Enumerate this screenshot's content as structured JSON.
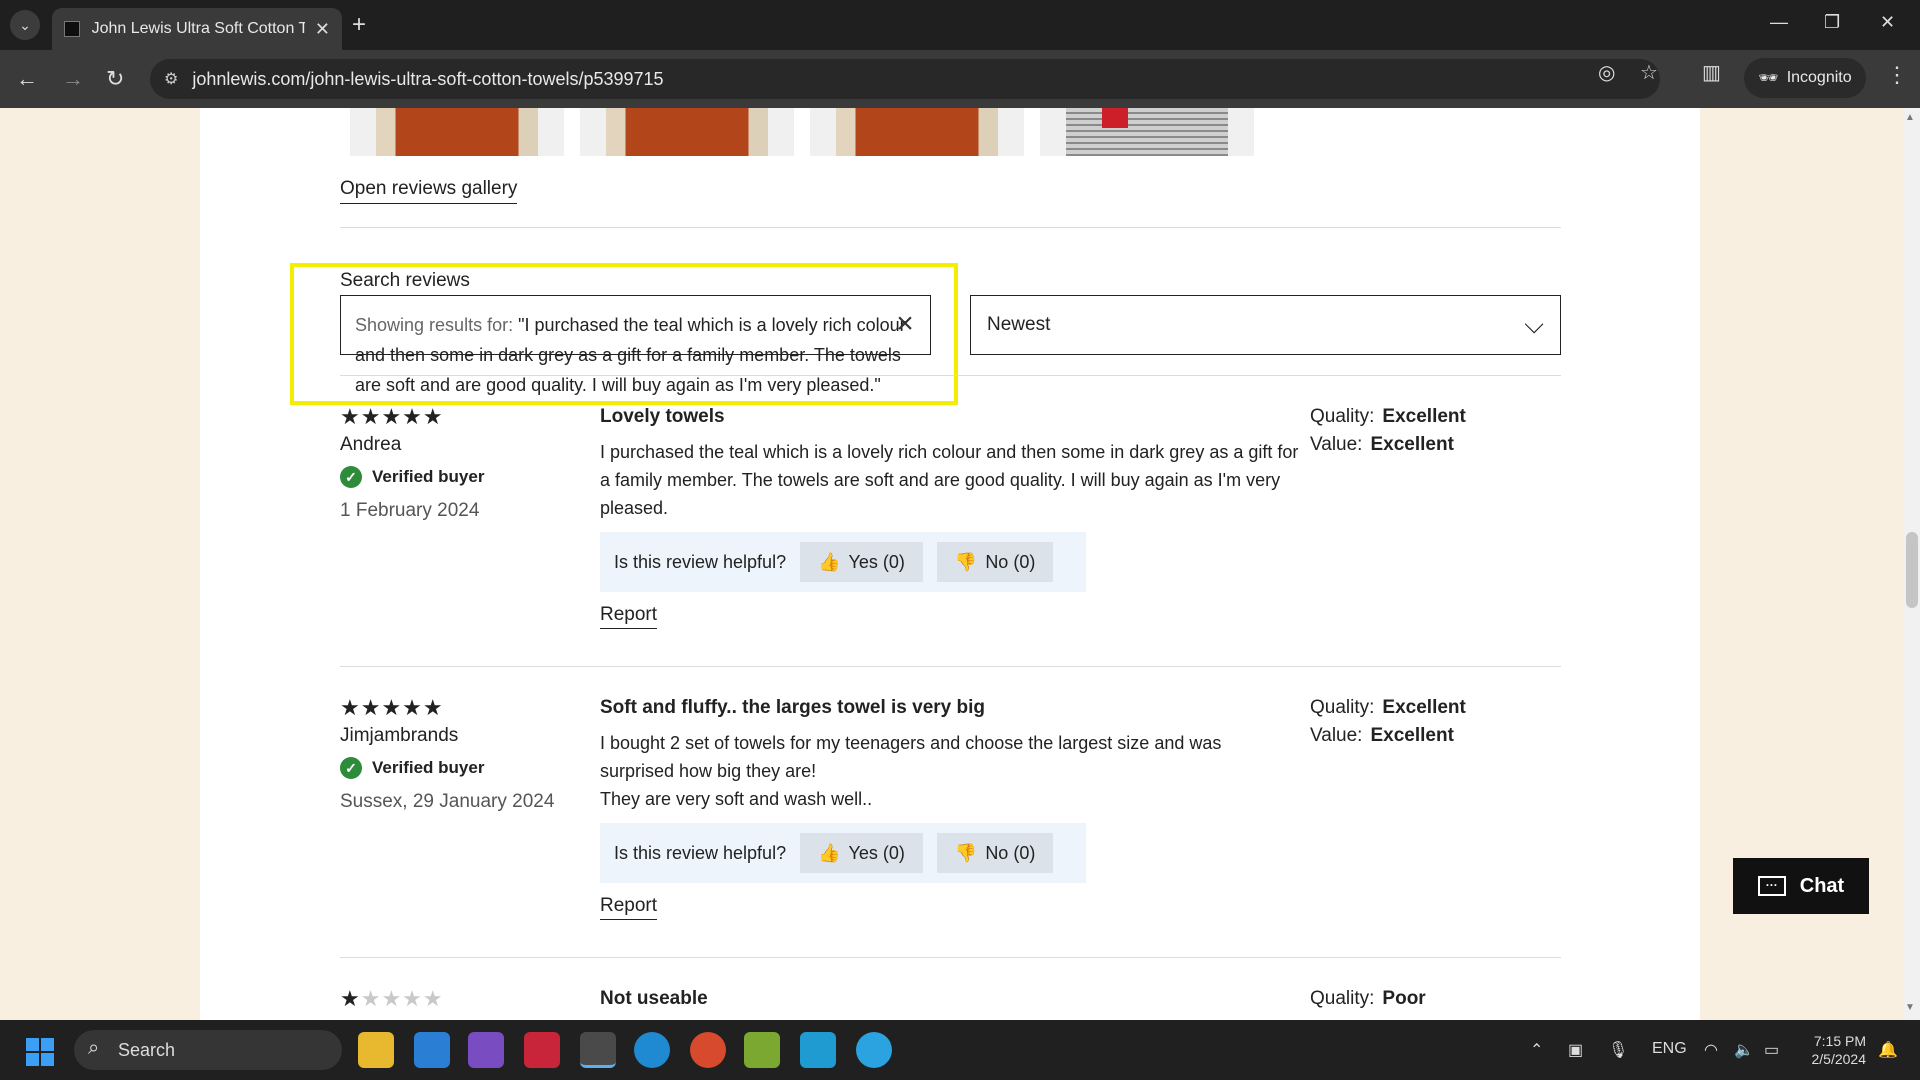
{
  "browser": {
    "tab_title": "John Lewis Ultra Soft Cotton Towels",
    "url": "johnlewis.com/john-lewis-ultra-soft-cotton-towels/p5399715",
    "incognito_label": "Incognito"
  },
  "gallery": {
    "link_label": "Open reviews gallery"
  },
  "search": {
    "label": "Search reviews",
    "prefix": "Showing results for:",
    "query": "\"I purchased the teal which is a lovely rich colour and then some in dark grey as a gift for a family member. The towels are soft and are good quality. I will buy again as I'm very pleased.\""
  },
  "sort": {
    "selected": "Newest"
  },
  "helpful_prompt": "Is this review helpful?",
  "report_label": "Report",
  "verified_label": "Verified buyer",
  "quality_label": "Quality:",
  "value_label": "Value:",
  "reviews": [
    {
      "stars": 5,
      "author": "Andrea",
      "date": "1 February 2024",
      "title": "Lovely towels",
      "body": "I purchased the teal which is a lovely rich colour and then some in dark grey as a gift for a family member. The towels are soft and are good quality. I will buy again as I'm very pleased.",
      "yes": "Yes (0)",
      "no": "No (0)",
      "quality": "Excellent",
      "value": "Excellent"
    },
    {
      "stars": 5,
      "author": "Jimjambrands",
      "date": "Sussex, 29 January 2024",
      "title": "Soft and fluffy.. the larges towel is very big",
      "body": "I bought 2 set of towels for my teenagers and choose the largest size and was surprised how big they are!\nThey are very soft and wash well..",
      "yes": "Yes (0)",
      "no": "No (0)",
      "quality": "Excellent",
      "value": "Excellent"
    },
    {
      "stars": 1,
      "title": "Not useable",
      "quality": "Poor"
    }
  ],
  "chat_label": "Chat",
  "taskbar": {
    "search_label": "Search",
    "lang": "ENG",
    "time": "7:15 PM",
    "date": "2/5/2024"
  },
  "colors": {
    "highlight": "#f3ee00",
    "verified": "#2e8b3a",
    "page_bg": "#f8efe1"
  }
}
